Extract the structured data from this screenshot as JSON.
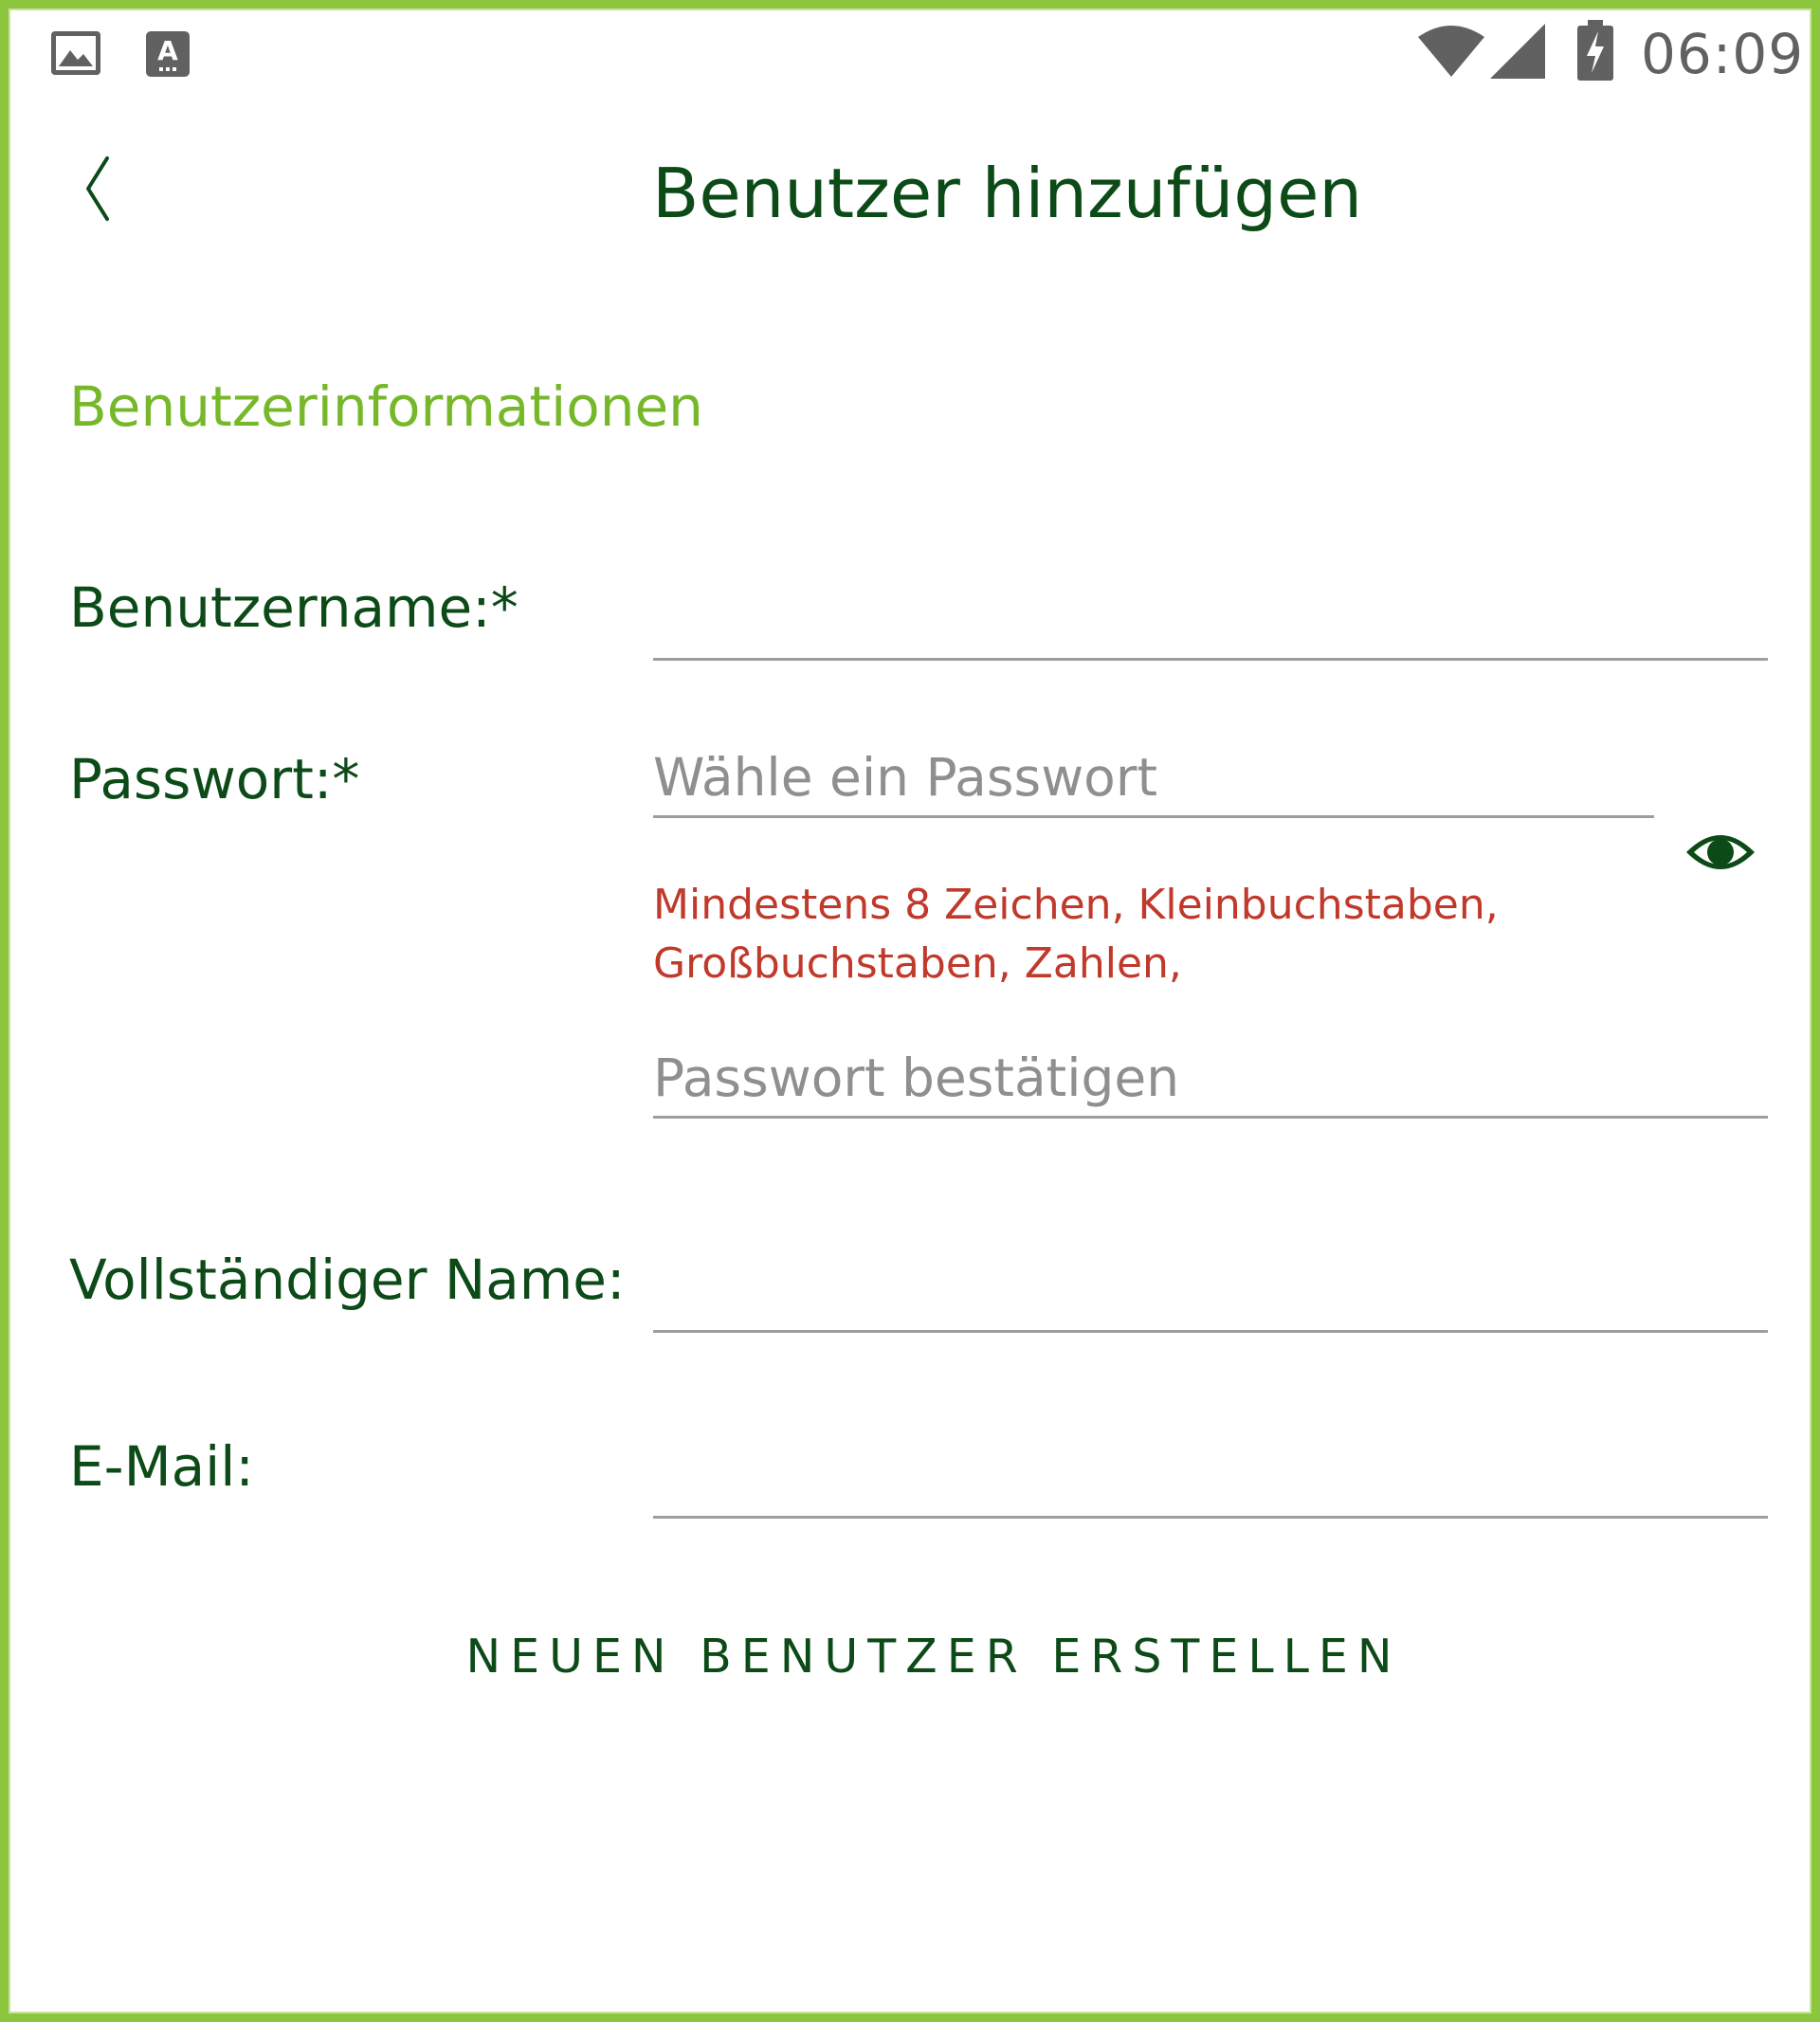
{
  "status_bar": {
    "time": "06:09",
    "icons": [
      "gallery-icon",
      "keyboard-icon",
      "wifi-icon",
      "signal-icon",
      "battery-charging-icon"
    ]
  },
  "header": {
    "back_icon": "chevron-left-icon",
    "title": "Benutzer hinzufügen"
  },
  "section_title": "Benutzerinformationen",
  "form": {
    "username": {
      "label": "Benutzername:*",
      "value": ""
    },
    "password": {
      "label": "Passwort:*",
      "placeholder": "Wähle ein Passwort",
      "value": "",
      "visibility_icon": "eye-icon",
      "hint_line1": "Mindestens 8 Zeichen, Kleinbuchstaben,",
      "hint_line2": "Großbuchstaben, Zahlen,"
    },
    "password_confirm": {
      "placeholder": "Passwort bestätigen",
      "value": ""
    },
    "full_name": {
      "label": "Vollständiger Name:",
      "value": ""
    },
    "email": {
      "label": "E-Mail:",
      "value": ""
    }
  },
  "actions": {
    "create_label": "NEUEN BENUTZER ERSTELLEN"
  },
  "colors": {
    "primary_dark_green": "#0c4a17",
    "accent_green": "#76b82a",
    "frame_green": "#8cc63f",
    "error_red": "#c0392b",
    "placeholder_gray": "#8f8f8f",
    "underline_gray": "#9e9e9e"
  }
}
